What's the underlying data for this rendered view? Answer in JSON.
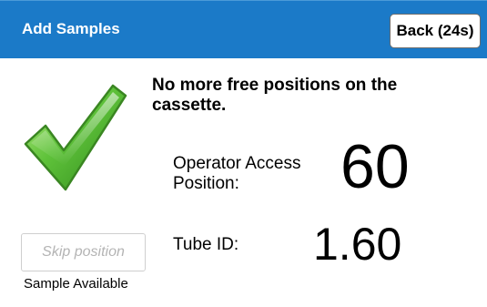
{
  "header": {
    "title": "Add Samples",
    "back_label": "Back (24s)",
    "background_color": "#1b7ac8"
  },
  "status": {
    "icon": "checkmark-icon",
    "icon_color": "#4caf2e",
    "message": "No more free positions on the cassette."
  },
  "operator_access": {
    "label": "Operator Access Position:",
    "value": "60"
  },
  "tube": {
    "label": "Tube ID:",
    "value": "1.60"
  },
  "skip": {
    "label": "Skip position",
    "enabled": false
  },
  "sample_status": "Sample Available"
}
